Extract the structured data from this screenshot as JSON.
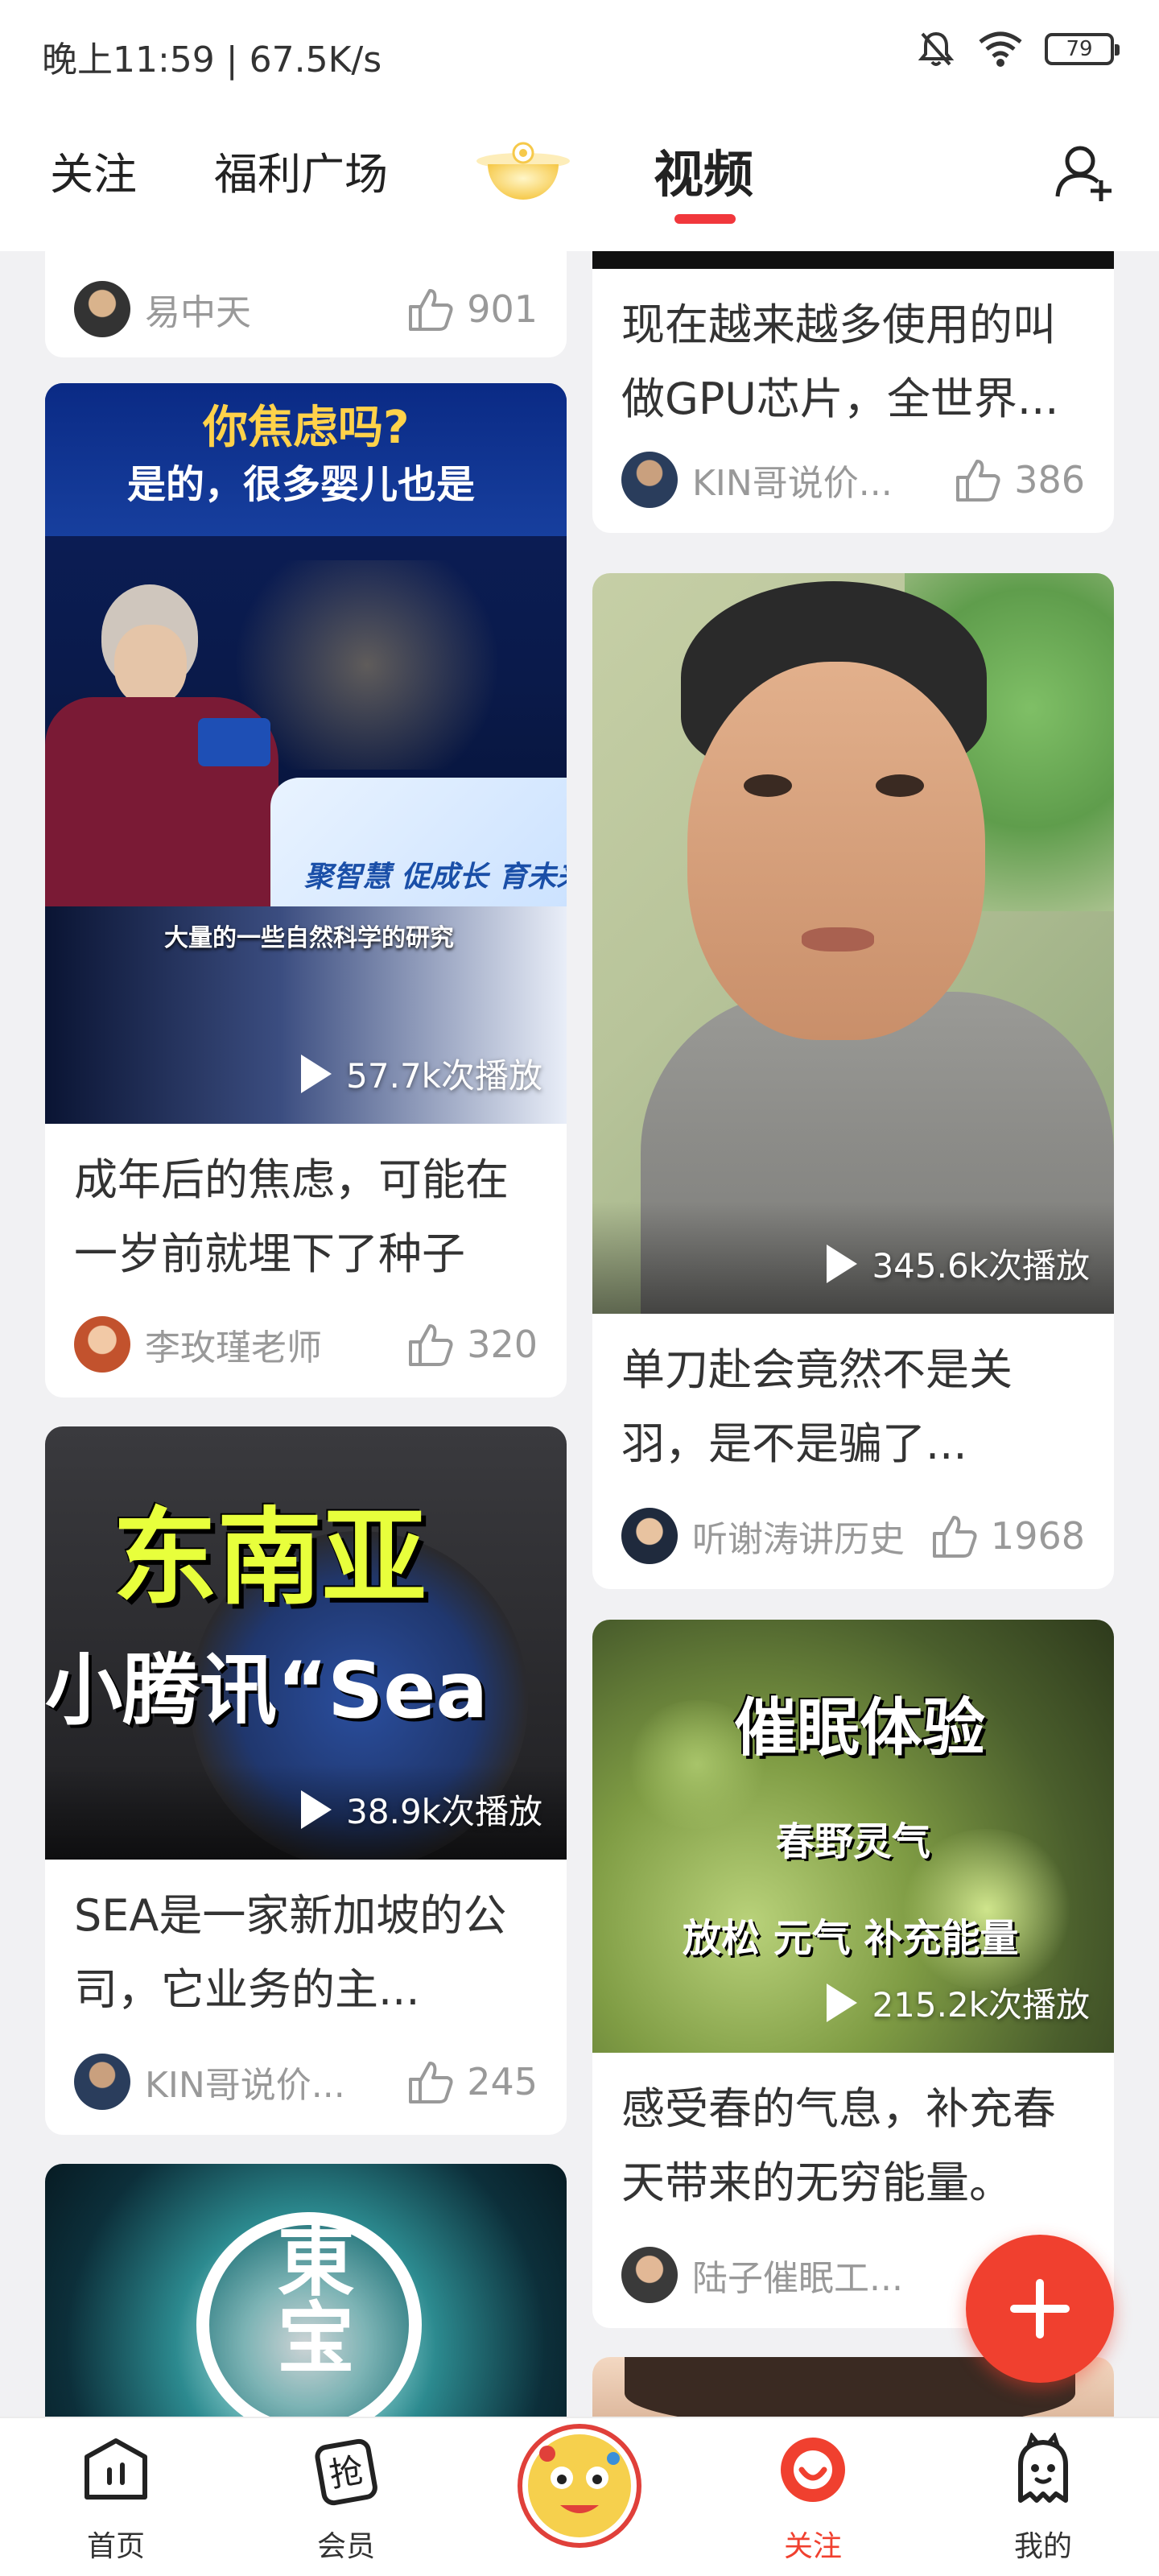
{
  "status_bar": {
    "time_speed": "晚上11:59 | 67.5K/s",
    "battery": "79"
  },
  "top_nav": {
    "tabs": [
      "关注",
      "福利广场",
      "视频"
    ],
    "active_tab": "视频"
  },
  "feed": {
    "cards": [
      {
        "id": "c0",
        "title": "",
        "author": "易中天",
        "likes": "901"
      },
      {
        "id": "c1",
        "title": "现在越来越多使用的叫做GPU芯片，全世界...",
        "author": "KIN哥说价...",
        "likes": "386"
      },
      {
        "id": "c2",
        "title": "成年后的焦虑，可能在一岁前就埋下了种子",
        "author": "李玫瑾老师",
        "likes": "320",
        "plays": "57.7k次播放",
        "overlay_line1": "你焦虑吗?",
        "overlay_line2": "是的，很多婴儿也是",
        "subtitle": "大量的一些自然科学的研究",
        "banner_text": "聚智慧 促成长 育未来"
      },
      {
        "id": "c3",
        "title": "单刀赴会竟然不是关羽，是不是骗了...",
        "author": "听谢涛讲历史",
        "likes": "1968",
        "plays": "345.6k次播放"
      },
      {
        "id": "c4",
        "title": "SEA是一家新加坡的公司，它业务的主...",
        "author": "KIN哥说价...",
        "likes": "245",
        "plays": "38.9k次播放",
        "overlay_line1": "东南亚",
        "overlay_line2": "小腾讯“Sea"
      },
      {
        "id": "c5",
        "title": "感受春的气息，补充春天带来的无穷能量。",
        "author": "陆子催眠工...",
        "likes": "",
        "plays": "215.2k次播放",
        "overlay_line1": "催眠体验",
        "overlay_line2": "春野灵气",
        "overlay_line3": "放松 元气 补充能量"
      },
      {
        "id": "c6",
        "overlay_text": "東宝"
      }
    ]
  },
  "bottom_nav": {
    "items": [
      "首页",
      "会员",
      "",
      "关注",
      "我的"
    ],
    "active": "关注"
  },
  "colors": {
    "accent": "#f0402f",
    "tab_indicator": "#f1373c",
    "muted_text": "#999999"
  }
}
